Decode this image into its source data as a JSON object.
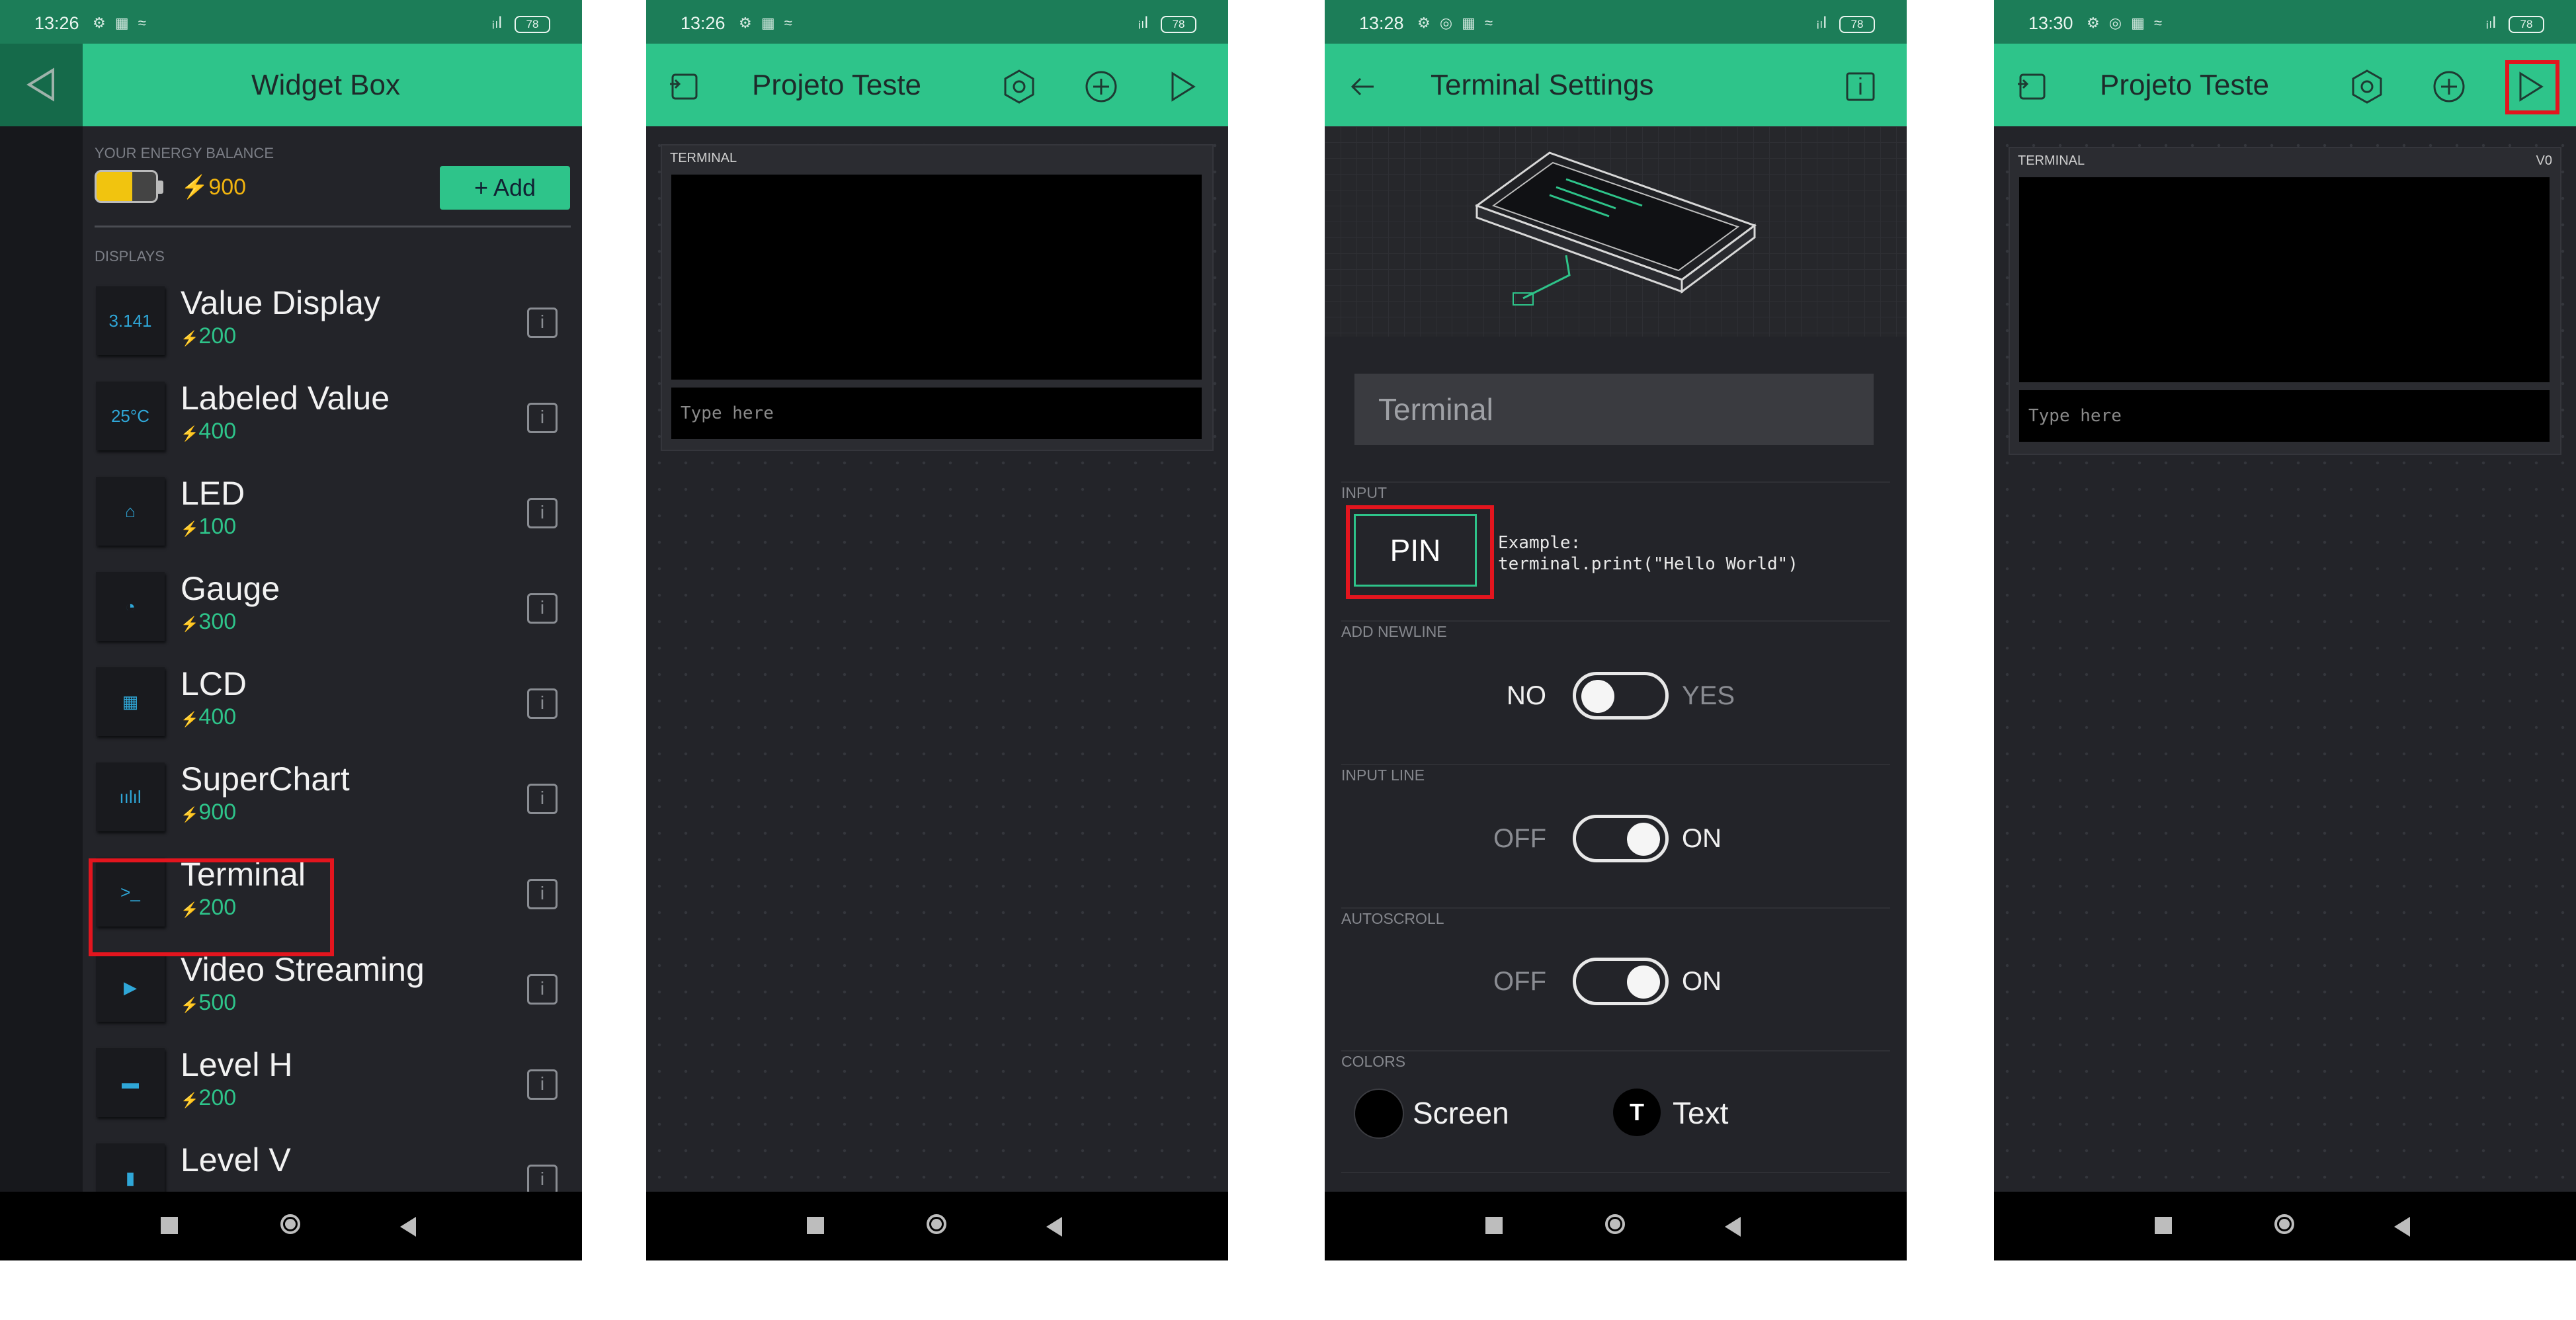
{
  "phone1": {
    "status_time": "13:26",
    "battery": "78",
    "title": "Widget Box",
    "energy_label": "YOUR ENERGY BALANCE",
    "energy_value": "900",
    "add_label": "+ Add",
    "displays_label": "DISPLAYS",
    "widgets": [
      {
        "name": "Value Display",
        "cost": "200",
        "icon": "value-display-icon",
        "glyph": "3.141"
      },
      {
        "name": "Labeled Value",
        "cost": "400",
        "icon": "labeled-value-icon",
        "glyph": "25°C"
      },
      {
        "name": "LED",
        "cost": "100",
        "icon": "led-icon",
        "glyph": "⌂"
      },
      {
        "name": "Gauge",
        "cost": "300",
        "icon": "gauge-icon",
        "glyph": "◔"
      },
      {
        "name": "LCD",
        "cost": "400",
        "icon": "lcd-icon",
        "glyph": "▦"
      },
      {
        "name": "SuperChart",
        "cost": "900",
        "icon": "superchart-icon",
        "glyph": "ıılıl"
      },
      {
        "name": "Terminal",
        "cost": "200",
        "icon": "terminal-icon",
        "glyph": ">_"
      },
      {
        "name": "Video Streaming",
        "cost": "500",
        "icon": "video-streaming-icon",
        "glyph": "▶"
      },
      {
        "name": "Level H",
        "cost": "200",
        "icon": "level-h-icon",
        "glyph": "▬"
      },
      {
        "name": "Level V",
        "cost": "",
        "icon": "level-v-icon",
        "glyph": "▮"
      }
    ],
    "info_glyph": "i"
  },
  "phone2": {
    "status_time": "13:26",
    "battery": "78",
    "title": "Projeto Teste",
    "terminal_label": "TERMINAL",
    "input_placeholder": "Type here"
  },
  "phone3": {
    "status_time": "13:28",
    "battery": "78",
    "title": "Terminal Settings",
    "name_value": "Terminal",
    "input_label": "INPUT",
    "pin_label": "PIN",
    "example_line1": "Example:",
    "example_line2": "terminal.print(\"Hello World\")",
    "add_newline_label": "ADD NEWLINE",
    "newline_off": "NO",
    "newline_on": "YES",
    "newline_state": false,
    "input_line_label": "INPUT LINE",
    "input_line_off": "OFF",
    "input_line_on": "ON",
    "input_line_state": true,
    "autoscroll_label": "AUTOSCROLL",
    "autoscroll_off": "OFF",
    "autoscroll_on": "ON",
    "autoscroll_state": true,
    "colors_label": "COLORS",
    "screen_label": "Screen",
    "text_label": "Text",
    "text_glyph": "T"
  },
  "phone4": {
    "status_time": "13:30",
    "battery": "78",
    "title": "Projeto Teste",
    "terminal_label": "TERMINAL",
    "pin_value": "V0",
    "input_placeholder": "Type here"
  },
  "colors": {
    "accent": "#2ec48a",
    "status_bar": "#1c7d58",
    "highlight": "#e3151e",
    "background": "#232429"
  }
}
